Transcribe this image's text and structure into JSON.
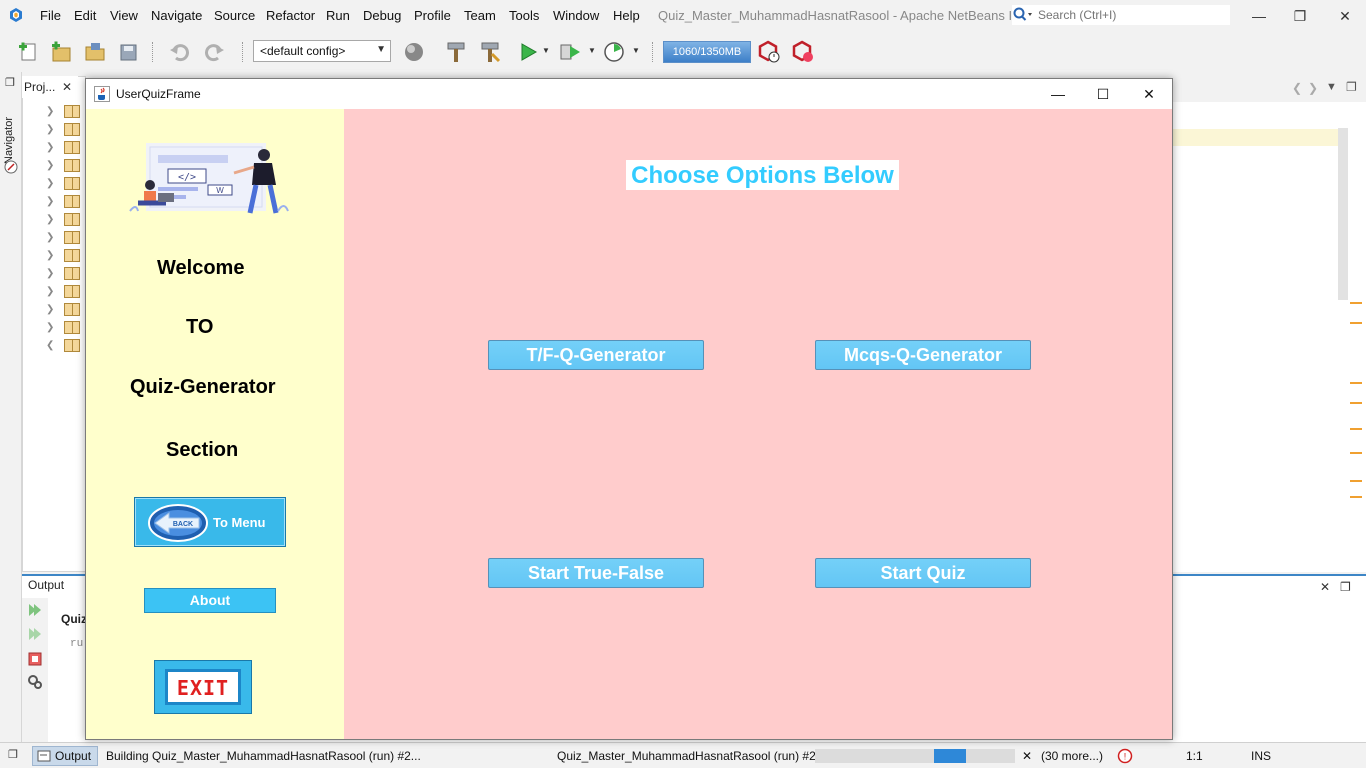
{
  "ide": {
    "menu": [
      "File",
      "Edit",
      "View",
      "Navigate",
      "Source",
      "Refactor",
      "Run",
      "Debug",
      "Profile",
      "Team",
      "Tools",
      "Window",
      "Help"
    ],
    "window_title": "Quiz_Master_MuhammadHasnatRasool - Apache NetBeans ID...",
    "search_placeholder": "Search (Ctrl+I)",
    "config": "<default config>",
    "memory": "1060/1350MB",
    "projects_tab": "Proj...",
    "navigator_tab": "Navigator",
    "output_tab": "Output",
    "output_line": "Quiz",
    "output_run": "ru"
  },
  "statusbar": {
    "output_button": "Output",
    "building": "Building Quiz_Master_MuhammadHasnatRasool (run) #2...",
    "task": "Quiz_Master_MuhammadHasnatRasool (run) #2",
    "progress": 0.66,
    "more": "(30 more...)",
    "position": "1:1",
    "mode": "INS"
  },
  "frame": {
    "title": "UserQuizFrame",
    "welcome": [
      "Welcome",
      "TO",
      "Quiz-Generator",
      "Section"
    ],
    "back_button": "To Menu",
    "back_badge": "BACK",
    "about_button": "About",
    "exit_button": "EXIT",
    "heading": "Choose Options Below",
    "buttons": {
      "tf_generator": "T/F-Q-Generator",
      "mcqs_generator": "Mcqs-Q-Generator",
      "start_true_false": "Start True-False",
      "start_quiz": "Start Quiz"
    },
    "illustration_code": "</>"
  },
  "colors": {
    "side_panel": "#ffffcc",
    "main_panel": "#ffcccc",
    "heading": "#33ccff",
    "button": "#66c8f6",
    "exit_text": "#e02020"
  }
}
